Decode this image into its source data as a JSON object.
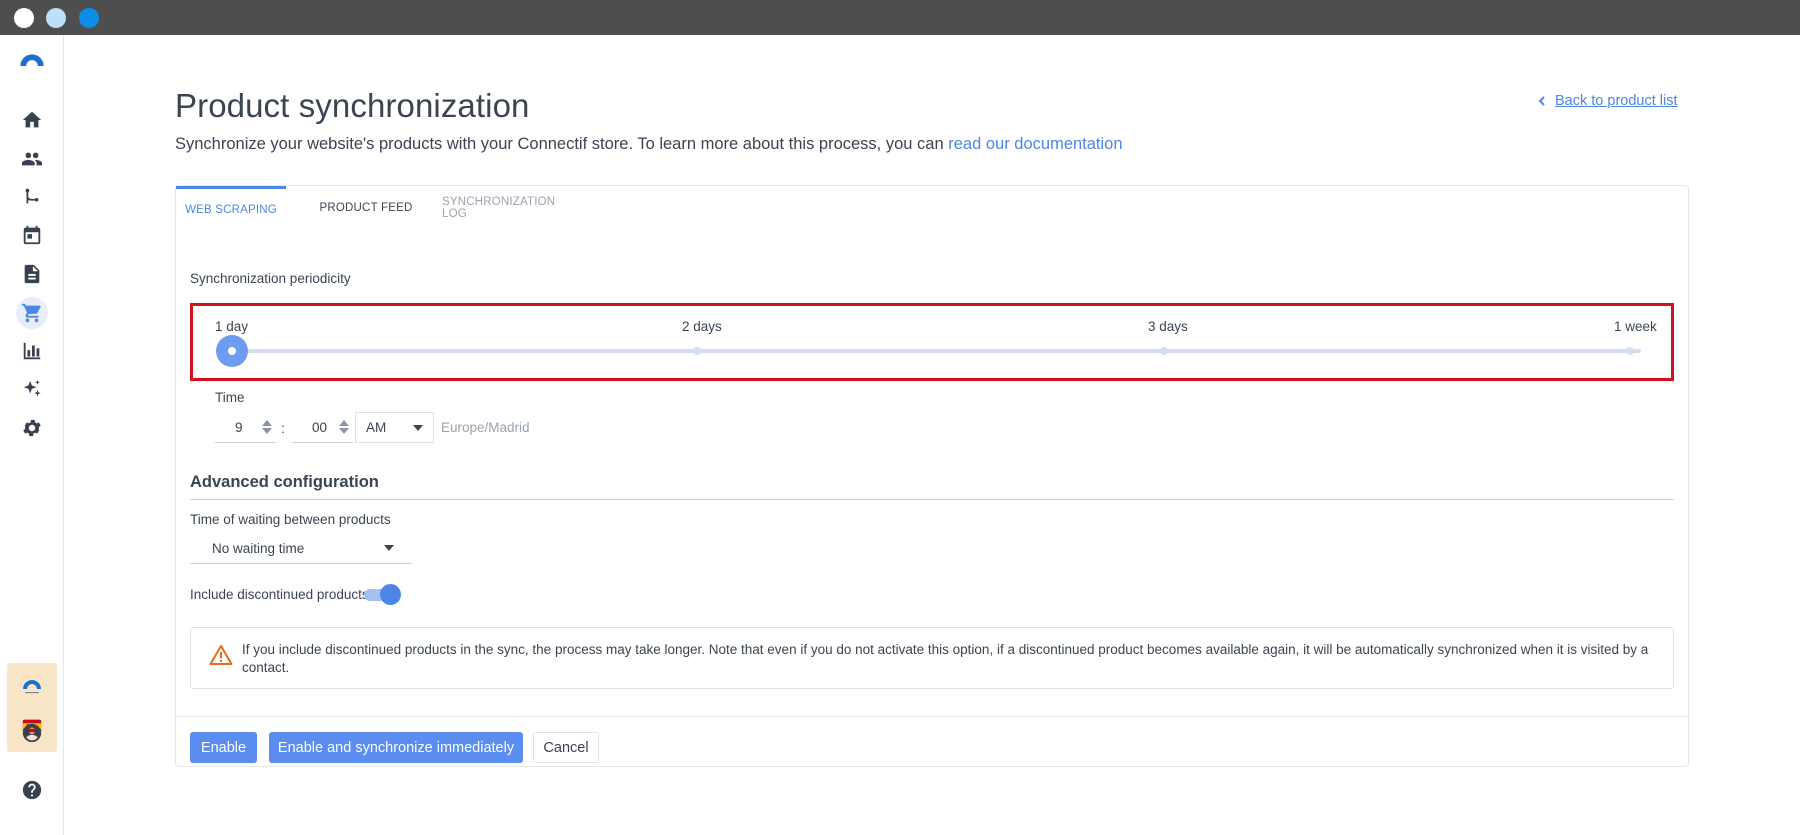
{
  "window": {
    "controls": [
      "#ffffff",
      "#bde0fa",
      "#0a8ee8"
    ]
  },
  "colors": {
    "accent": "#4e86e8",
    "highlight": "#d10f1e",
    "warning": "#e56b1f"
  },
  "sidebar": {
    "items": [
      {
        "icon": "logo-icon"
      },
      {
        "icon": "home-icon"
      },
      {
        "icon": "contacts-icon"
      },
      {
        "icon": "workflow-icon"
      },
      {
        "icon": "calendar-icon"
      },
      {
        "icon": "document-icon"
      },
      {
        "icon": "cart-icon",
        "active": true
      },
      {
        "icon": "chart-icon"
      },
      {
        "icon": "sparkle-icon"
      },
      {
        "icon": "gear-icon"
      },
      {
        "icon": "account-icon"
      },
      {
        "icon": "help-icon"
      }
    ]
  },
  "header": {
    "title": "Product synchronization",
    "subtitle": "Synchronize your website's products with your Connectif store. To learn more about this process, you can",
    "doc_link": "read our documentation",
    "back_link": "Back to product list"
  },
  "tabs": [
    {
      "label": "WEB SCRAPING",
      "active": true
    },
    {
      "label": "PRODUCT FEED",
      "active": false
    },
    {
      "label": "SYNCHRONIZATION LOG",
      "active": false
    }
  ],
  "periodicity": {
    "label": "Synchronization periodicity",
    "options": [
      "1 day",
      "2 days",
      "3 days",
      "1 week"
    ],
    "selected_index": 0
  },
  "time": {
    "label": "Time",
    "hour": "9",
    "separator": ":",
    "minute": "00",
    "period": "AM",
    "timezone": "Europe/Madrid"
  },
  "advanced": {
    "title": "Advanced configuration",
    "wait_label": "Time of waiting between products",
    "wait_value": "No waiting time",
    "discontinued_label": "Include discontinued products",
    "discontinued_enabled": true,
    "warning": "If you include discontinued products in the sync, the process may take longer. Note that even if you do not activate this option, if a discontinued product becomes available again, it will be automatically synchronized when it is visited by a contact."
  },
  "actions": {
    "enable": "Enable",
    "enable_sync": "Enable and synchronize immediately",
    "cancel": "Cancel"
  }
}
